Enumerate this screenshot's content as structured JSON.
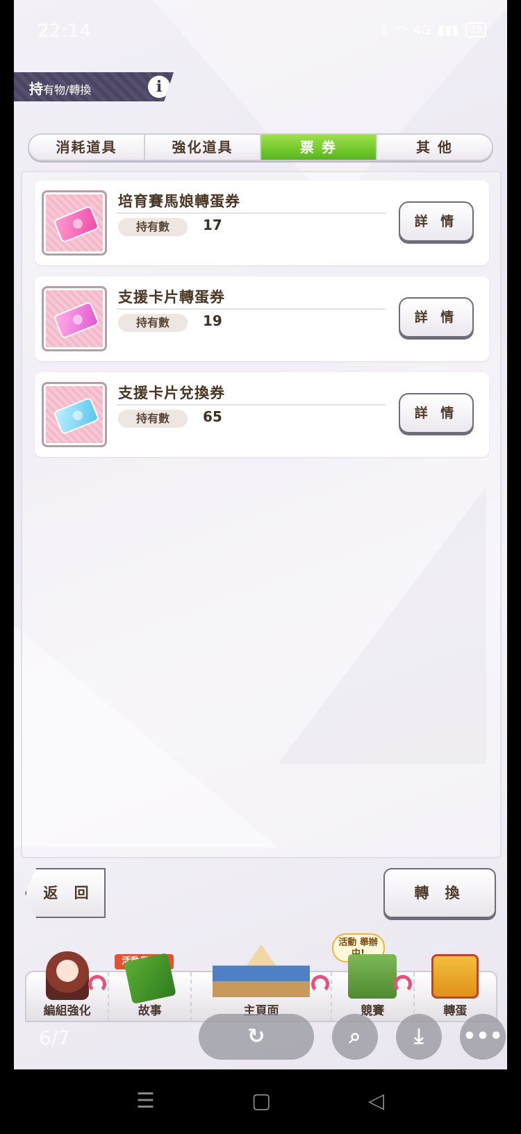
{
  "status_bar": {
    "time": "22:14",
    "network": "4G",
    "battery": "39"
  },
  "header": {
    "title_main": "持",
    "title_rest": "有物/轉換",
    "info_icon": "i"
  },
  "tabs": [
    {
      "label": "消耗道具",
      "active": false
    },
    {
      "label": "強化道具",
      "active": false
    },
    {
      "label": "票 券",
      "active": true
    },
    {
      "label": "其 他",
      "active": false
    }
  ],
  "items": [
    {
      "name": "培育賽馬娘轉蛋券",
      "count_label": "持有數",
      "count": "17",
      "detail_label": "詳 情",
      "icon": "pink-ticket-icon"
    },
    {
      "name": "支援卡片轉蛋券",
      "count_label": "持有數",
      "count": "19",
      "detail_label": "詳 情",
      "icon": "magenta-ticket-icon"
    },
    {
      "name": "支援卡片兌換券",
      "count_label": "持有數",
      "count": "65",
      "detail_label": "詳 情",
      "icon": "blue-ticket-icon"
    }
  ],
  "actions": {
    "back_label": "返 回",
    "convert_label": "轉 換"
  },
  "bottom_nav": {
    "items": [
      {
        "label": "編組強化"
      },
      {
        "label": "故事",
        "banner": "活動舉辦中"
      },
      {
        "label": "主頁面"
      },
      {
        "label": "競賽",
        "bubble": "活動 舉辦中!"
      },
      {
        "label": "轉蛋"
      }
    ]
  },
  "viewer": {
    "page_indicator": "6/7"
  },
  "colors": {
    "active_tab": "#55b81b",
    "text_brown": "#4d3a2a",
    "header_bg": "#4a4560"
  }
}
